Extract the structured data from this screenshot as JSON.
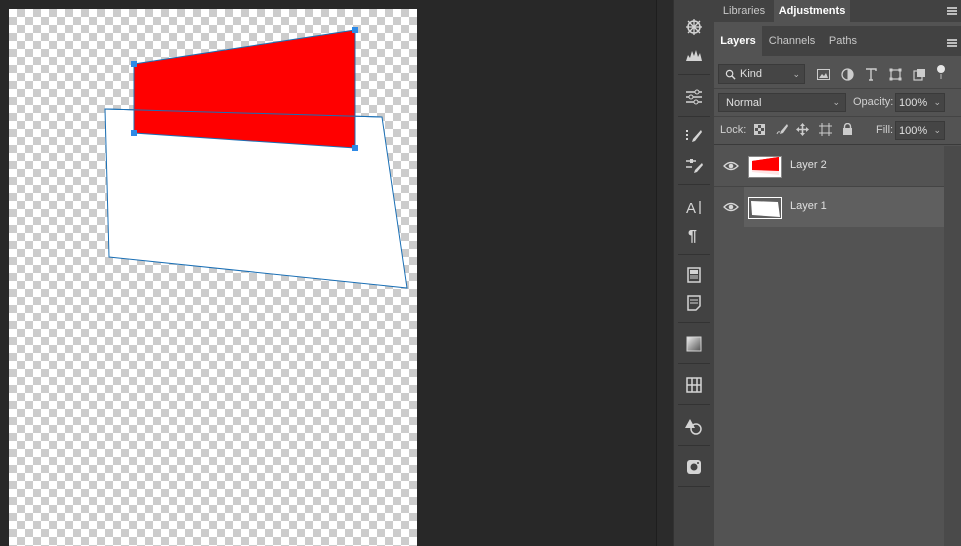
{
  "panels": {
    "top_tabs": [
      "Libraries",
      "Adjustments"
    ],
    "top_active": "Adjustments",
    "tabs": [
      "Layers",
      "Channels",
      "Paths"
    ],
    "active_tab": "Layers"
  },
  "filter": {
    "kind_label": "Kind"
  },
  "blend": {
    "mode": "Normal",
    "opacity_label": "Opacity:",
    "opacity_value": "100%"
  },
  "lock": {
    "label": "Lock:",
    "fill_label": "Fill:",
    "fill_value": "100%"
  },
  "layers": [
    {
      "name": "Layer 2",
      "thumb_color": "#ff0000",
      "selected": false,
      "visible": true
    },
    {
      "name": "Layer 1",
      "thumb_color": "#ffffff",
      "selected": true,
      "visible": true
    }
  ],
  "canvas": {
    "red_shape_color": "#ff0000",
    "white_shape_color": "#ffffff",
    "path_color": "#1a6fb5"
  },
  "toolstrip_icons": [
    "color-wheel-icon",
    "histogram-icon",
    "adjustments-sliders-icon",
    "brushes-icon",
    "brush-settings-icon",
    "character-icon",
    "paragraph-icon",
    "properties-icon",
    "notes-icon",
    "gradients-icon",
    "patterns-icon",
    "shapes-icon",
    "instagram-icon"
  ]
}
